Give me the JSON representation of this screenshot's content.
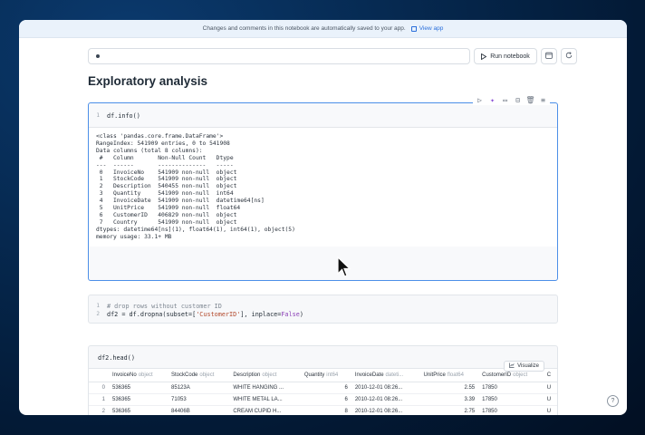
{
  "banner": {
    "message": "Changes and comments in this notebook are automatically saved to your app.",
    "link": "View app"
  },
  "toolbar": {
    "run_label": "Run notebook"
  },
  "page": {
    "heading": "Exploratory analysis"
  },
  "cell1": {
    "line_numbers": [
      "1"
    ],
    "code": "df.info()",
    "output": "<class 'pandas.core.frame.DataFrame'>\nRangeIndex: 541909 entries, 0 to 541908\nData columns (total 8 columns):\n #   Column       Non-Null Count   Dtype\n---  ------       --------------   -----\n 0   InvoiceNo    541909 non-null  object\n 1   StockCode    541909 non-null  object\n 2   Description  540455 non-null  object\n 3   Quantity     541909 non-null  int64\n 4   InvoiceDate  541909 non-null  datetime64[ns]\n 5   UnitPrice    541909 non-null  float64\n 6   CustomerID   406829 non-null  object\n 7   Country      541909 non-null  object\ndtypes: datetime64[ns](1), float64(1), int64(1), object(5)\nmemory usage: 33.1+ MB"
  },
  "cell2": {
    "line1": "# drop rows without customer ID",
    "line2_pre": "df2 = df.dropna(subset=[",
    "line2_str": "'CustomerID'",
    "line2_mid": "], inplace=",
    "line2_kw": "False",
    "line2_post": ")",
    "ln1": "1",
    "ln2": "2"
  },
  "cell3": {
    "code": "df2.head()",
    "visualize_label": "Visualize",
    "columns": [
      {
        "name": "InvoiceNo",
        "type": "object"
      },
      {
        "name": "StockCode",
        "type": "object"
      },
      {
        "name": "Description",
        "type": "object"
      },
      {
        "name": "Quantity",
        "type": "int64"
      },
      {
        "name": "InvoiceDate",
        "type": "dateti..."
      },
      {
        "name": "UnitPrice",
        "type": "float64"
      },
      {
        "name": "CustomerID",
        "type": "object"
      },
      {
        "name": "C",
        "type": ""
      }
    ],
    "rows": [
      {
        "idx": "0",
        "cells": [
          "536365",
          "85123A",
          "WHITE HANGING ...",
          "6",
          "2010-12-01 08:26...",
          "2.55",
          "17850",
          "U"
        ]
      },
      {
        "idx": "1",
        "cells": [
          "536365",
          "71053",
          "WHITE METAL LA...",
          "6",
          "2010-12-01 08:26...",
          "3.39",
          "17850",
          "U"
        ]
      },
      {
        "idx": "2",
        "cells": [
          "536365",
          "84406B",
          "CREAM CUPID H...",
          "8",
          "2010-12-01 08:26...",
          "2.75",
          "17850",
          "U"
        ]
      }
    ]
  },
  "icons": {
    "external": "external-link-icon",
    "play": "play-icon",
    "calendar": "calendar-icon",
    "refresh": "refresh-icon",
    "help": "help-icon"
  }
}
